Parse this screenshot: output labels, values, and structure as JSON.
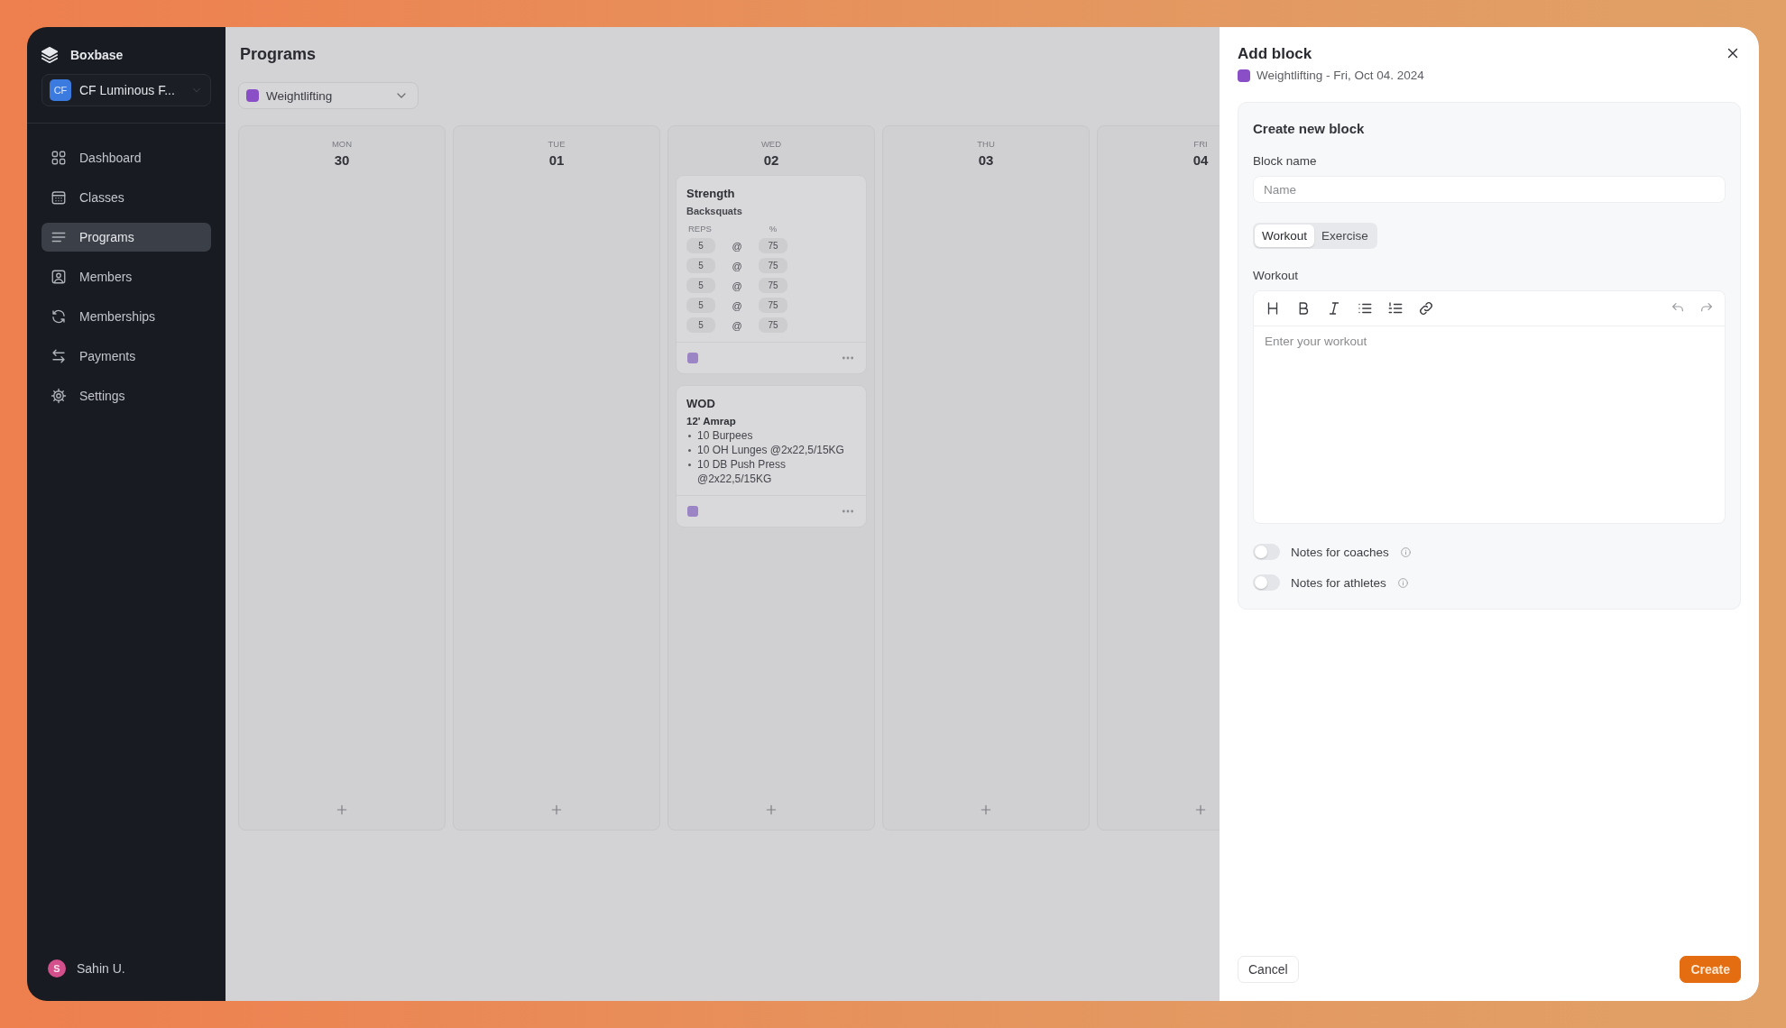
{
  "sidebar": {
    "brand": "Boxbase",
    "workspace": {
      "initials": "CF",
      "name": "CF Luminous F..."
    },
    "items": [
      {
        "label": "Dashboard",
        "selected": false
      },
      {
        "label": "Classes",
        "selected": false
      },
      {
        "label": "Programs",
        "selected": true
      },
      {
        "label": "Members",
        "selected": false
      },
      {
        "label": "Memberships",
        "selected": false
      },
      {
        "label": "Payments",
        "selected": false
      },
      {
        "label": "Settings",
        "selected": false
      }
    ],
    "user": {
      "initial": "S",
      "name": "Sahin U."
    }
  },
  "main": {
    "title": "Programs",
    "program_select": {
      "value": "Weightlifting",
      "color": "#8a4fc7"
    },
    "days": [
      {
        "weekday": "MON",
        "date": "30"
      },
      {
        "weekday": "TUE",
        "date": "01"
      },
      {
        "weekday": "WED",
        "date": "02",
        "blocks": [
          {
            "kind": "sets",
            "title": "Strength",
            "exercise": "Backsquats",
            "columns": [
              "REPS",
              "%"
            ],
            "color": "#9c85c4",
            "sets": [
              {
                "reps": "5",
                "separator": "@",
                "percent": "75"
              },
              {
                "reps": "5",
                "separator": "@",
                "percent": "75"
              },
              {
                "reps": "5",
                "separator": "@",
                "percent": "75"
              },
              {
                "reps": "5",
                "separator": "@",
                "percent": "75"
              },
              {
                "reps": "5",
                "separator": "@",
                "percent": "75"
              }
            ]
          },
          {
            "kind": "text",
            "title": "WOD",
            "heading": "12' Amrap",
            "color": "#9c85c4",
            "items": [
              "10 Burpees",
              "10 OH Lunges @2x22,5/15KG",
              "10 DB Push Press @2x22,5/15KG"
            ]
          }
        ]
      },
      {
        "weekday": "THU",
        "date": "03"
      },
      {
        "weekday": "FRI",
        "date": "04"
      }
    ]
  },
  "panel": {
    "title": "Add block",
    "subtitle": "Weightlifting - Fri, Oct 04. 2024",
    "color": "#8a4fc7",
    "section_title": "Create new block",
    "name_label": "Block name",
    "name_placeholder": "Name",
    "tabs": [
      {
        "label": "Workout",
        "selected": true
      },
      {
        "label": "Exercise",
        "selected": false
      }
    ],
    "editor_label": "Workout",
    "editor_placeholder": "Enter your workout",
    "toggles": [
      {
        "label": "Notes for coaches",
        "on": false
      },
      {
        "label": "Notes for athletes",
        "on": false
      }
    ],
    "buttons": {
      "cancel": "Cancel",
      "create": "Create"
    }
  }
}
